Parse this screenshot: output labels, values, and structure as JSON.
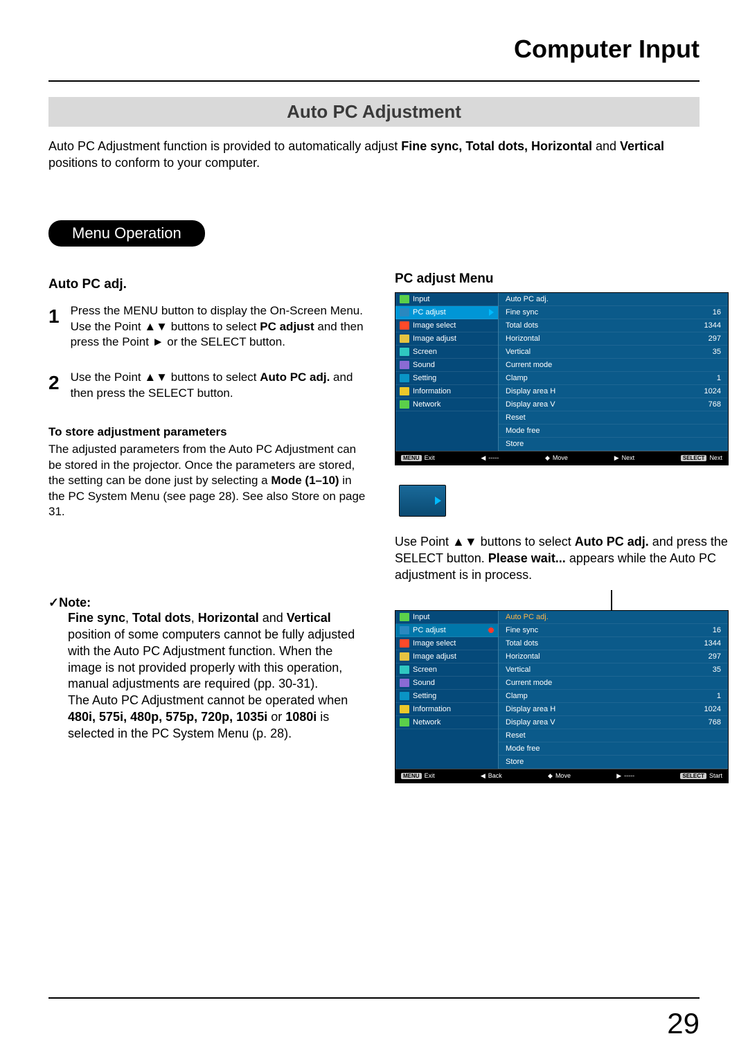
{
  "chapter_title": "Computer Input",
  "section_title": "Auto PC Adjustment",
  "intro_pre": "Auto PC Adjustment function is provided to automatically adjust ",
  "intro_bold": "Fine sync, Total dots, Horizontal",
  "intro_mid": " and ",
  "intro_bold2": "Vertical",
  "intro_post": " positions to conform to your computer.",
  "menu_operation_label": "Menu Operation",
  "left": {
    "heading": "Auto PC adj.",
    "step1_pre": "Press the MENU button to display the On-Screen Menu. Use the Point ▲▼ buttons to select ",
    "step1_b": "PC adjust",
    "step1_post": " and then press the Point ► or the SELECT button.",
    "step2_pre": "Use the Point ▲▼ buttons to select ",
    "step2_b": "Auto PC adj.",
    "step2_post": " and then press the SELECT button.",
    "store_head": "To store adjustment parameters",
    "store_body_pre": "The adjusted parameters from the Auto PC Adjustment can be stored in the projector. Once the parameters are stored, the setting can be done just by selecting a ",
    "store_body_b": "Mode (1–10)",
    "store_body_post": " in the PC System Menu (see page 28). See also  Store  on page 31.",
    "note_label": "✓Note:",
    "note1_b1": "Fine sync",
    "note1_s1": ", ",
    "note1_b2": "Total dots",
    "note1_s2": ", ",
    "note1_b3": "Horizontal",
    "note1_s3": " and ",
    "note1_b4": "Vertical",
    "note1_post": " position of some computers cannot be fully adjusted with the Auto PC Adjustment function. When the image is not provided properly with this operation, manual adjustments are required (pp. 30-31).",
    "note2_pre": "The Auto PC Adjustment cannot be operated when ",
    "note2_b": "480i, 575i, 480p, 575p, 720p, 1035i",
    "note2_mid": " or ",
    "note2_b2": "1080i",
    "note2_post": " is selected in the PC System Menu (p. 28)."
  },
  "right": {
    "heading": "PC adjust Menu",
    "caption_pre": "Use Point ▲▼ buttons to select  ",
    "caption_b": "Auto PC adj.",
    "caption_mid": " and press the SELECT button. ",
    "caption_b2": "Please wait...",
    "caption_post": " appears while the Auto PC adjustment is in process."
  },
  "menu": {
    "side": [
      "Input",
      "PC adjust",
      "Image select",
      "Image adjust",
      "Screen",
      "Sound",
      "Setting",
      "Information",
      "Network"
    ],
    "items": [
      {
        "label": "Auto PC adj.",
        "val": ""
      },
      {
        "label": "Fine sync",
        "val": "16"
      },
      {
        "label": "Total dots",
        "val": "1344"
      },
      {
        "label": "Horizontal",
        "val": "297"
      },
      {
        "label": "Vertical",
        "val": "35"
      },
      {
        "label": "Current mode",
        "val": ""
      },
      {
        "label": "Clamp",
        "val": "1"
      },
      {
        "label": "Display area H",
        "val": "1024"
      },
      {
        "label": "Display area V",
        "val": "768"
      },
      {
        "label": "Reset",
        "val": ""
      },
      {
        "label": "Mode free",
        "val": ""
      },
      {
        "label": "Store",
        "val": ""
      }
    ],
    "footer1": {
      "exit": "Exit",
      "left": "-----",
      "move": "Move",
      "next": "Next",
      "sel": "Next",
      "menu": "MENU",
      "select": "SELECT"
    },
    "footer2": {
      "exit": "Exit",
      "back": "Back",
      "move": "Move",
      "dash": "-----",
      "start": "Start",
      "menu": "MENU",
      "select": "SELECT"
    }
  },
  "page_number": "29"
}
